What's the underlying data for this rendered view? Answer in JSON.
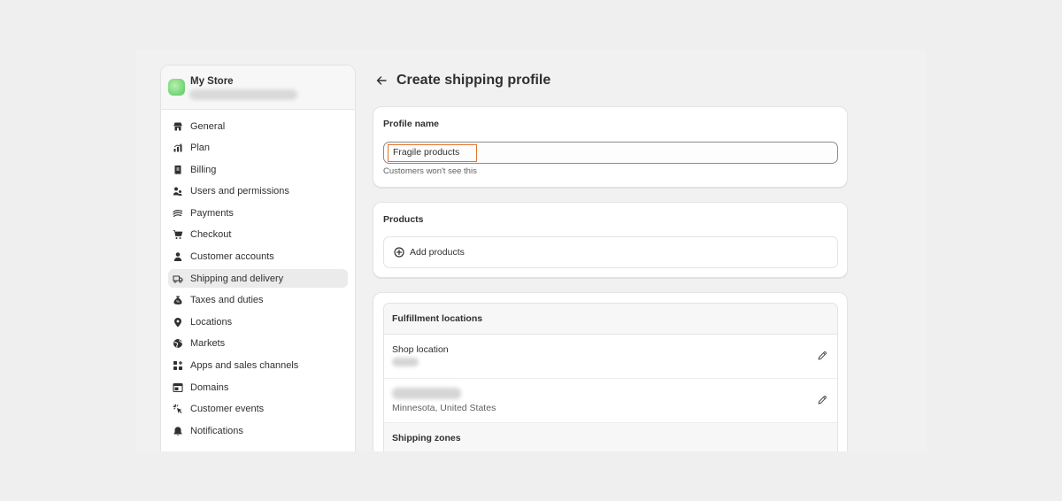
{
  "store": {
    "name": "My Store"
  },
  "sidebar": {
    "items": [
      {
        "label": "General",
        "icon": "store-icon"
      },
      {
        "label": "Plan",
        "icon": "plan-chart-icon"
      },
      {
        "label": "Billing",
        "icon": "receipt-icon"
      },
      {
        "label": "Users and permissions",
        "icon": "users-icon"
      },
      {
        "label": "Payments",
        "icon": "payments-icon"
      },
      {
        "label": "Checkout",
        "icon": "cart-icon"
      },
      {
        "label": "Customer accounts",
        "icon": "person-icon"
      },
      {
        "label": "Shipping and delivery",
        "icon": "truck-icon",
        "active": true
      },
      {
        "label": "Taxes and duties",
        "icon": "tax-bag-icon"
      },
      {
        "label": "Locations",
        "icon": "location-pin-icon"
      },
      {
        "label": "Markets",
        "icon": "globe-icon"
      },
      {
        "label": "Apps and sales channels",
        "icon": "apps-icon"
      },
      {
        "label": "Domains",
        "icon": "domains-icon"
      },
      {
        "label": "Customer events",
        "icon": "cursor-click-icon"
      },
      {
        "label": "Notifications",
        "icon": "bell-icon"
      }
    ]
  },
  "header": {
    "title": "Create shipping profile"
  },
  "profile": {
    "label": "Profile name",
    "value": "Fragile products",
    "help": "Customers won't see this"
  },
  "products": {
    "label": "Products",
    "add_label": "Add products"
  },
  "fulfillment": {
    "label": "Fulfillment locations",
    "locations": [
      {
        "title": "Shop location"
      },
      {
        "subtitle": "Minnesota, United States"
      }
    ],
    "zones_label": "Shipping zones"
  },
  "colors": {
    "input_highlight": "#e3742f",
    "active_nav": "#ebebeb"
  }
}
